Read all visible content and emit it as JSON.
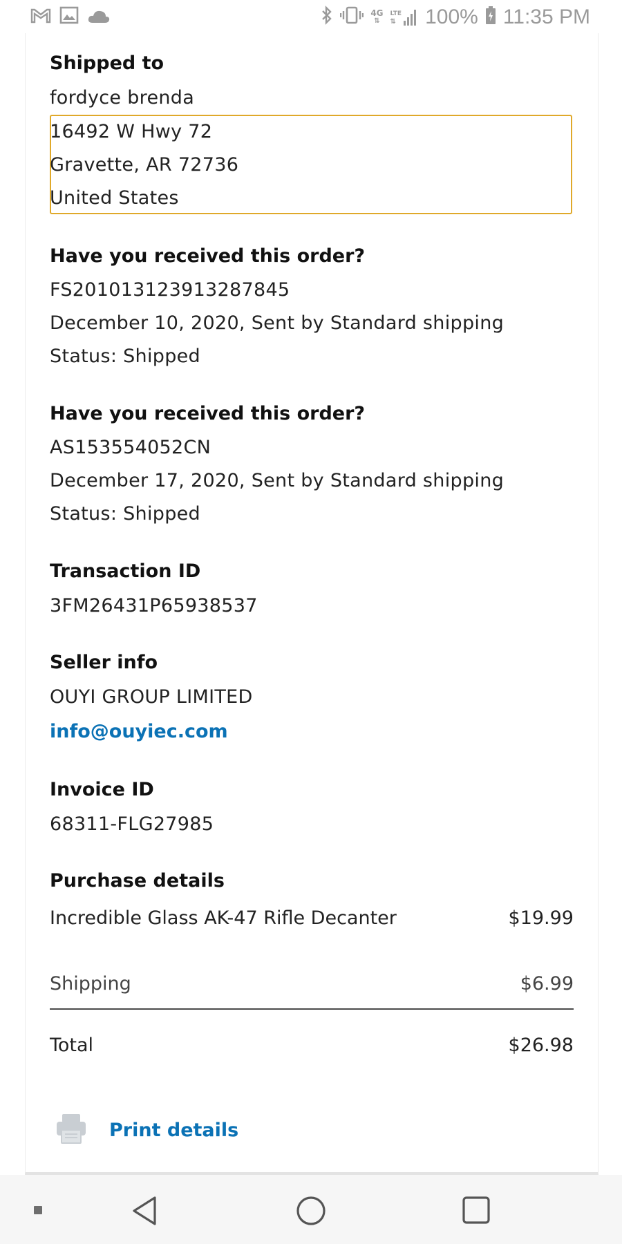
{
  "status_bar": {
    "network_label": "4G",
    "lte_label": "LTE",
    "battery": "100%",
    "time": "11:35 PM",
    "icons": [
      "gmail-icon",
      "image-icon",
      "cloud-icon",
      "bluetooth-icon",
      "vibrate-icon",
      "signal-icon",
      "battery-icon"
    ]
  },
  "shipped_to": {
    "heading": "Shipped to",
    "name": "fordyce brenda",
    "street": "16492 W Hwy 72",
    "city_line": "Gravette, AR 72736",
    "country": "United States"
  },
  "shipments": [
    {
      "heading": "Have you received this order?",
      "tracking": "FS201013123913287845",
      "date_line": "December 10, 2020, Sent by Standard shipping",
      "status": "Status: Shipped"
    },
    {
      "heading": "Have you received this order?",
      "tracking": "AS153554052CN",
      "date_line": "December 17, 2020, Sent by Standard shipping",
      "status": "Status: Shipped"
    }
  ],
  "transaction": {
    "heading": "Transaction ID",
    "value": "3FM26431P65938537"
  },
  "seller": {
    "heading": "Seller info",
    "name": "OUYI GROUP LIMITED",
    "email": "info@ouyiec.com"
  },
  "invoice": {
    "heading": "Invoice ID",
    "value": "68311-FLG27985"
  },
  "purchase": {
    "heading": "Purchase details",
    "item_name": "Incredible Glass AK-47 Rifle Decanter",
    "item_price": "$19.99",
    "shipping_label": "Shipping",
    "shipping_price": "$6.99",
    "total_label": "Total",
    "total_price": "$26.98"
  },
  "print_label": "Print details",
  "colors": {
    "accent_link": "#0b72b5",
    "highlight_border": "#e0a92a"
  }
}
